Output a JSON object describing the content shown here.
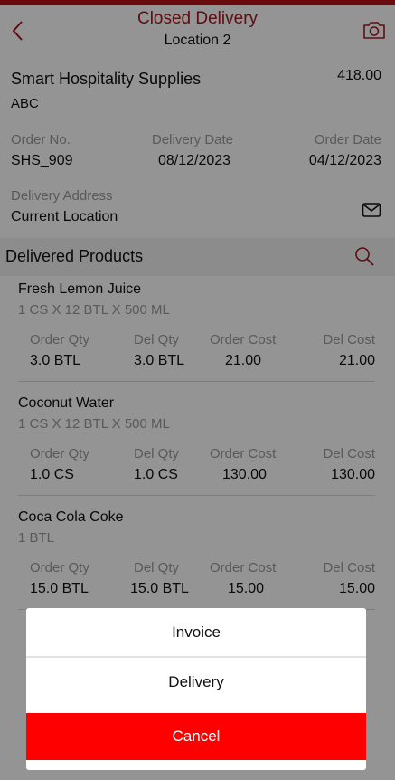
{
  "colors": {
    "brand": "#b3141b",
    "title": "#a3191f",
    "cancel": "#ff0000"
  },
  "header": {
    "title": "Closed Delivery",
    "subtitle": "Location 2",
    "back_icon": "chevron-left-icon",
    "camera_icon": "camera-icon"
  },
  "supplier": {
    "name": "Smart Hospitality Supplies",
    "amount": "418.00",
    "code": "ABC"
  },
  "order": {
    "order_no_label": "Order No.",
    "order_no": "SHS_909",
    "delivery_date_label": "Delivery Date",
    "delivery_date": "08/12/2023",
    "order_date_label": "Order Date",
    "order_date": "04/12/2023"
  },
  "address": {
    "label": "Delivery Address",
    "value": "Current Location",
    "icon": "mail-icon"
  },
  "section": {
    "title": "Delivered Products",
    "search_icon": "search-icon"
  },
  "columns": {
    "order_qty": "Order Qty",
    "del_qty": "Del Qty",
    "order_cost": "Order Cost",
    "del_cost": "Del Cost"
  },
  "products": [
    {
      "name": "Fresh Lemon Juice",
      "pack": "1 CS X 12 BTL X 500 ML",
      "order_qty": "3.0 BTL",
      "del_qty": "3.0 BTL",
      "order_cost": "21.00",
      "del_cost": "21.00"
    },
    {
      "name": "Coconut Water",
      "pack": "1 CS X 12 BTL X 500 ML",
      "order_qty": "1.0 CS",
      "del_qty": "1.0 CS",
      "order_cost": "130.00",
      "del_cost": "130.00"
    },
    {
      "name": "Coca Cola Coke",
      "pack": "1 BTL",
      "order_qty": "15.0 BTL",
      "del_qty": "15.0 BTL",
      "order_cost": "15.00",
      "del_cost": "15.00"
    }
  ],
  "action_sheet": {
    "invoice": "Invoice",
    "delivery": "Delivery",
    "cancel": "Cancel"
  }
}
